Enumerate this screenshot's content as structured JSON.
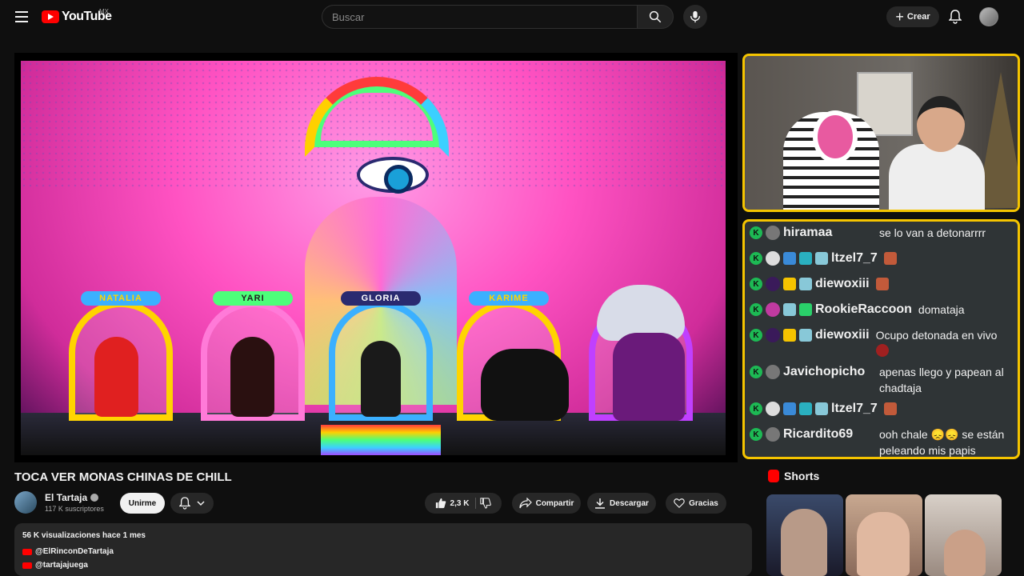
{
  "header": {
    "logo_text": "YouTube",
    "country_code": "MX",
    "search_placeholder": "Buscar",
    "create_label": "Crear"
  },
  "throne_labels": [
    "NATALIA",
    "YARI",
    "GLORIA",
    "KARIME"
  ],
  "chat": {
    "messages": [
      {
        "user": "hiramaa",
        "text": "se lo van a detonarrrr"
      },
      {
        "user": "ltzel7_7",
        "text": ""
      },
      {
        "user": "diewoxiii",
        "text": ""
      },
      {
        "user": "RookieRaccoon",
        "text": "domataja"
      },
      {
        "user": "diewoxiii",
        "text": "Ocupo detonada en vivo"
      },
      {
        "user": "Javichopicho",
        "text": "apenas llego y papean al chadtaja"
      },
      {
        "user": "ltzel7_7",
        "text": ""
      },
      {
        "user": "Ricardito69",
        "text": "ooh chale 😞😞 se están peleando mis papis"
      }
    ]
  },
  "video": {
    "title": "TOCA VER MONAS CHINAS DE CHILL",
    "channel_name": "El Tartaja",
    "subscribers": "117 K suscriptores",
    "join_label": "Unirme",
    "likes": "2,3 K",
    "share_label": "Compartir",
    "download_label": "Descargar",
    "thanks_label": "Gracias"
  },
  "description": {
    "meta": "56 K visualizaciones  hace 1 mes",
    "links": [
      "@ElRinconDeTartaja",
      "@tartajajuega"
    ]
  },
  "shorts": {
    "heading": "Shorts"
  },
  "colors": {
    "accent": "#ff0000",
    "frame": "#f5c400",
    "chat_bg": "#2f3436",
    "kick_green": "#1db954"
  }
}
